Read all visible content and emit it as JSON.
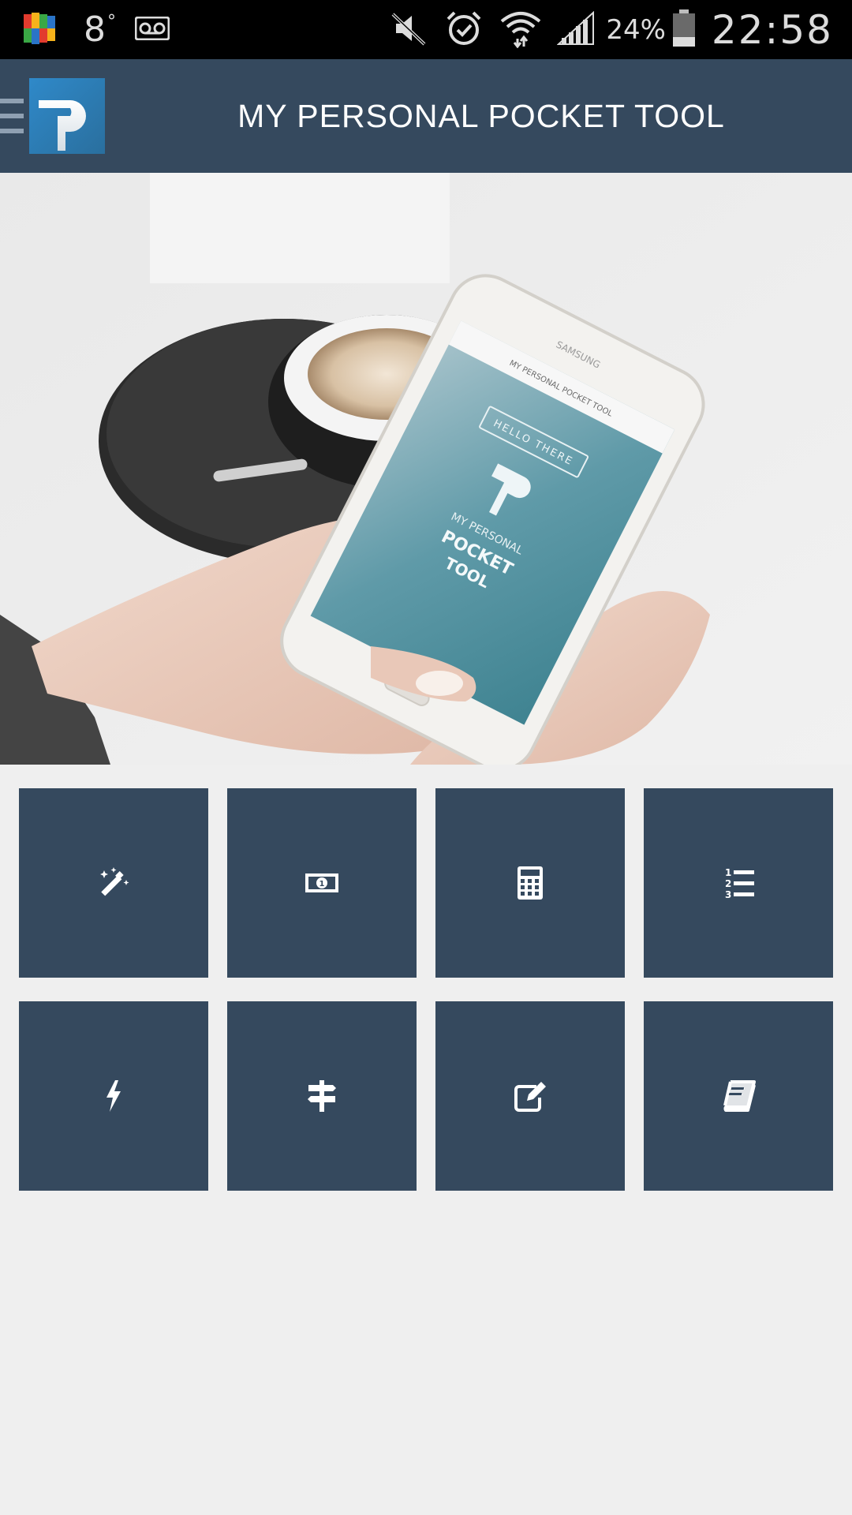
{
  "status_bar": {
    "temperature": "8",
    "temperature_unit": "°",
    "battery_percent": "24%",
    "time": "22:58",
    "icons": [
      "avg-antivirus-icon",
      "voicemail-icon",
      "mute-icon",
      "alarm-icon",
      "wifi-icon",
      "signal-icon",
      "battery-icon"
    ]
  },
  "app_bar": {
    "title": "MY PERSONAL POCKET TOOL",
    "menu_icon": "hamburger-menu-icon",
    "logo_icon": "app-logo-p"
  },
  "hero": {
    "phone_screen_lines": [
      "HELLO THERE",
      "MY PERSONAL",
      "POCKET",
      "TOOL"
    ],
    "phone_header_text": "MY PERSONAL POCKET TOOL",
    "phone_brand": "SAMSUNG"
  },
  "tiles": [
    {
      "icon": "magic-wand-icon"
    },
    {
      "icon": "banknote-icon"
    },
    {
      "icon": "calculator-icon"
    },
    {
      "icon": "numbered-list-icon"
    },
    {
      "icon": "lightning-bolt-icon"
    },
    {
      "icon": "signpost-icon"
    },
    {
      "icon": "edit-note-icon"
    },
    {
      "icon": "book-icon"
    }
  ],
  "colors": {
    "app_bar": "#35495e",
    "tile": "#35495e",
    "background": "#efefef",
    "status_bar": "#000000"
  }
}
